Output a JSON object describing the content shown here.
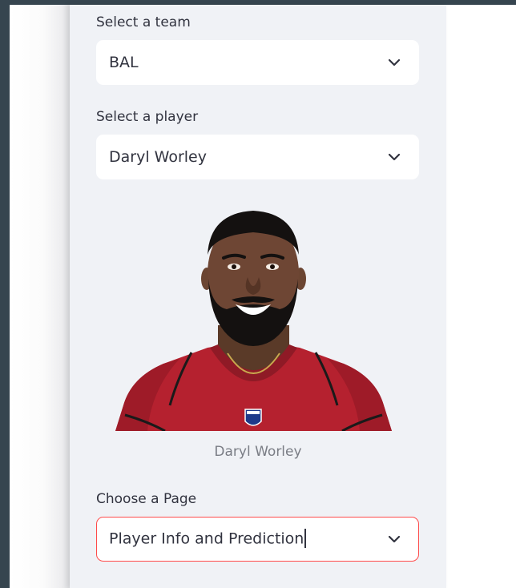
{
  "sidebar": {
    "team_select": {
      "label": "Select a team",
      "value": "BAL",
      "icon": "chevron-down-icon"
    },
    "player_select": {
      "label": "Select a player",
      "value": "Daryl Worley",
      "icon": "chevron-down-icon"
    },
    "player_photo": {
      "caption": "Daryl Worley"
    },
    "page_select": {
      "label": "Choose a Page",
      "value": "Player Info and Prediction",
      "icon": "chevron-down-icon"
    }
  },
  "colors": {
    "sidebar_bg": "#f0f2f6",
    "frame": "#36454f",
    "text": "#31333f",
    "focus_border": "#ff4b4b",
    "jersey": "#b5212f"
  }
}
